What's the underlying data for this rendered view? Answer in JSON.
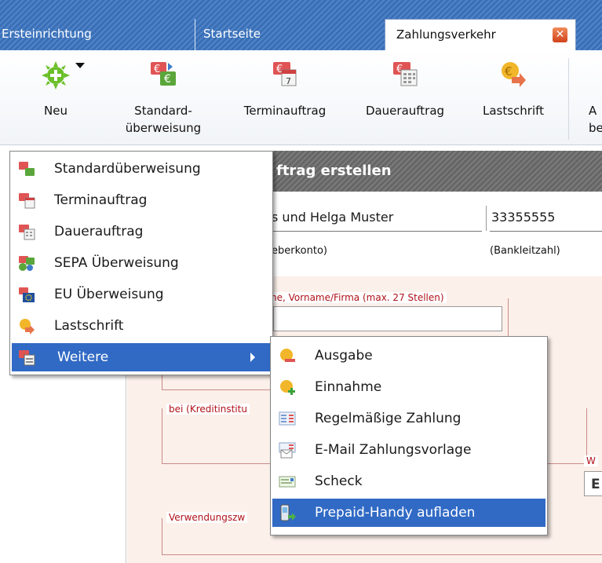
{
  "tabs": [
    {
      "label": "Ersteinrichtung"
    },
    {
      "label": "Startseite"
    },
    {
      "label": "Zahlungsverkehr",
      "active": true
    }
  ],
  "toolbar": {
    "buttons": [
      {
        "label": "Neu",
        "icon": "add-icon"
      },
      {
        "label": "Standard-\nüberweisung",
        "line1": "Standard-",
        "line2": "überweisung",
        "icon": "euro-transfer-icon"
      },
      {
        "label": "Terminauftrag",
        "icon": "calendar-euro-icon"
      },
      {
        "label": "Dauerauftrag",
        "icon": "recurring-euro-icon"
      },
      {
        "label": "Lastschrift",
        "icon": "euro-coin-arrow-icon"
      },
      {
        "label": "A\nbe",
        "line1": "A",
        "line2": "be",
        "icon": "truncated-button"
      }
    ]
  },
  "form": {
    "header_title": "ftrag erstellen",
    "account_name": "s und Helga Muster",
    "account_bank_code": "33355555",
    "account_caption": "eberkonto)",
    "bank_code_caption": "(Bankleitzahl)",
    "recipient_label": "ne, Vorname/Firma (max. 27 Stellen)",
    "bank_label": "bei (Kreditinstitu",
    "currency_label_1": "W",
    "currency_label_2": "E",
    "purpose_label": "Verwendungszw"
  },
  "new_menu": {
    "items": [
      {
        "label": "Standardüberweisung",
        "icon": "euro-transfer-icon"
      },
      {
        "label": "Terminauftrag",
        "icon": "calendar-euro-icon"
      },
      {
        "label": "Dauerauftrag",
        "icon": "recurring-euro-icon"
      },
      {
        "label": "SEPA Überweisung",
        "icon": "sepa-transfer-icon"
      },
      {
        "label": "EU Überweisung",
        "icon": "eu-transfer-icon"
      },
      {
        "label": "Lastschrift",
        "icon": "euro-coin-arrow-icon"
      },
      {
        "label": "Weitere",
        "icon": "more-icon",
        "highlighted": true,
        "has_submenu": true
      }
    ]
  },
  "sub_menu": {
    "items": [
      {
        "label": "Ausgabe",
        "icon": "euro-minus-icon"
      },
      {
        "label": "Einnahme",
        "icon": "euro-plus-icon"
      },
      {
        "label": "Regelmäßige Zahlung",
        "icon": "regular-payment-icon"
      },
      {
        "label": "E-Mail Zahlungsvorlage",
        "icon": "email-template-icon"
      },
      {
        "label": "Scheck",
        "icon": "cheque-icon"
      },
      {
        "label": "Prepaid-Handy aufladen",
        "icon": "mobile-phone-icon",
        "highlighted": true
      }
    ]
  },
  "colors": {
    "tab_bar": "#3a6fb6",
    "menu_highlight": "#316ac5",
    "form_label_red": "#b0111a",
    "form_background": "#fcf0ea"
  }
}
